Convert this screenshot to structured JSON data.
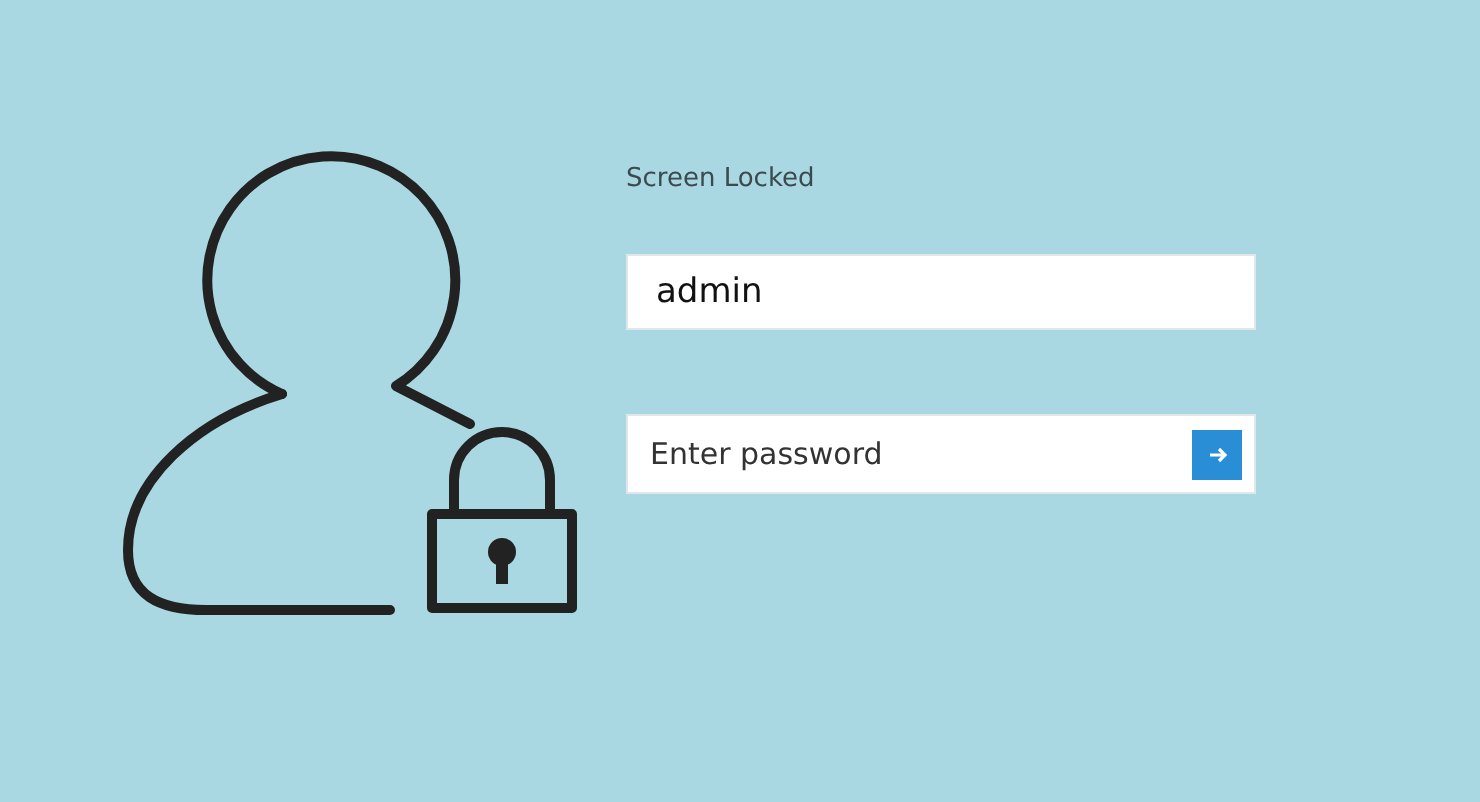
{
  "title": "Screen Locked",
  "username": {
    "value": "admin"
  },
  "password": {
    "placeholder": "Enter password"
  }
}
